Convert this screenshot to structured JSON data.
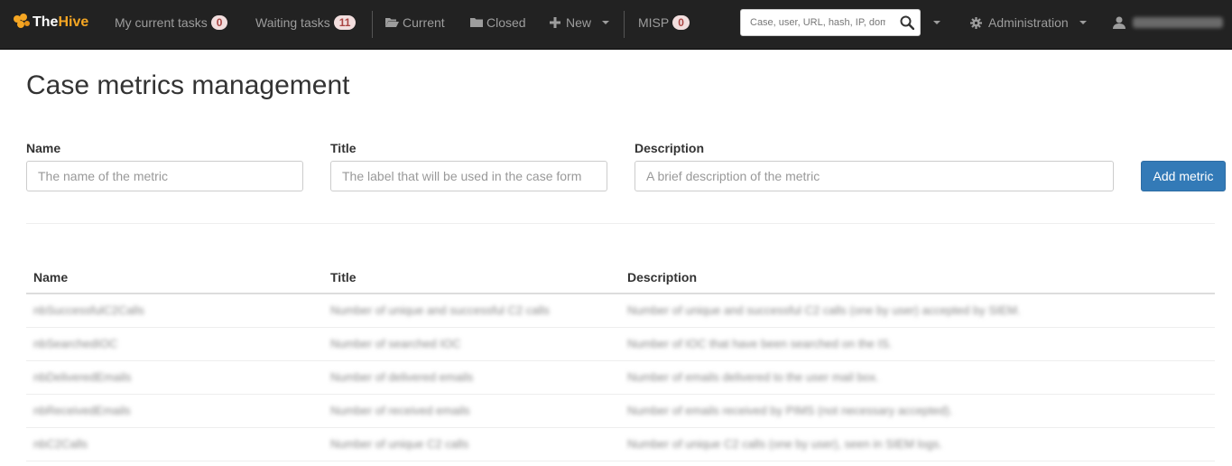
{
  "navbar": {
    "brand_the": "The",
    "brand_hive": "Hive",
    "my_tasks_label": "My current tasks",
    "my_tasks_count": "0",
    "waiting_tasks_label": "Waiting tasks",
    "waiting_tasks_count": "11",
    "current_label": "Current",
    "closed_label": "Closed",
    "new_label": "New",
    "misp_label": "MISP",
    "misp_count": "0",
    "search_placeholder": "Case, user, URL, hash, IP, domain",
    "administration_label": "Administration"
  },
  "page": {
    "title": "Case metrics management"
  },
  "form": {
    "name_label": "Name",
    "name_placeholder": "The name of the metric",
    "title_label": "Title",
    "title_placeholder": "The label that will be used in the case form",
    "description_label": "Description",
    "description_placeholder": "A brief description of the metric",
    "add_button": "Add metric"
  },
  "table": {
    "headers": [
      "Name",
      "Title",
      "Description"
    ],
    "rows": [
      [
        "nbSuccessfulC2Calls",
        "Number of unique and successful C2 calls",
        "Number of unique and successful C2 calls (one by user) accepted by SIEM."
      ],
      [
        "nbSearchedIOC",
        "Number of searched IOC",
        "Number of IOC that have been searched on the IS."
      ],
      [
        "nbDeliveredEmails",
        "Number of delivered emails",
        "Number of emails delivered to the user mail box."
      ],
      [
        "nbReceivedEmails",
        "Number of received emails",
        "Number of emails received by PIMS (not necessary accepted)."
      ],
      [
        "nbC2Calls",
        "Number of unique C2 calls",
        "Number of unique C2 calls (one by user), seen in SIEM logs."
      ]
    ]
  }
}
